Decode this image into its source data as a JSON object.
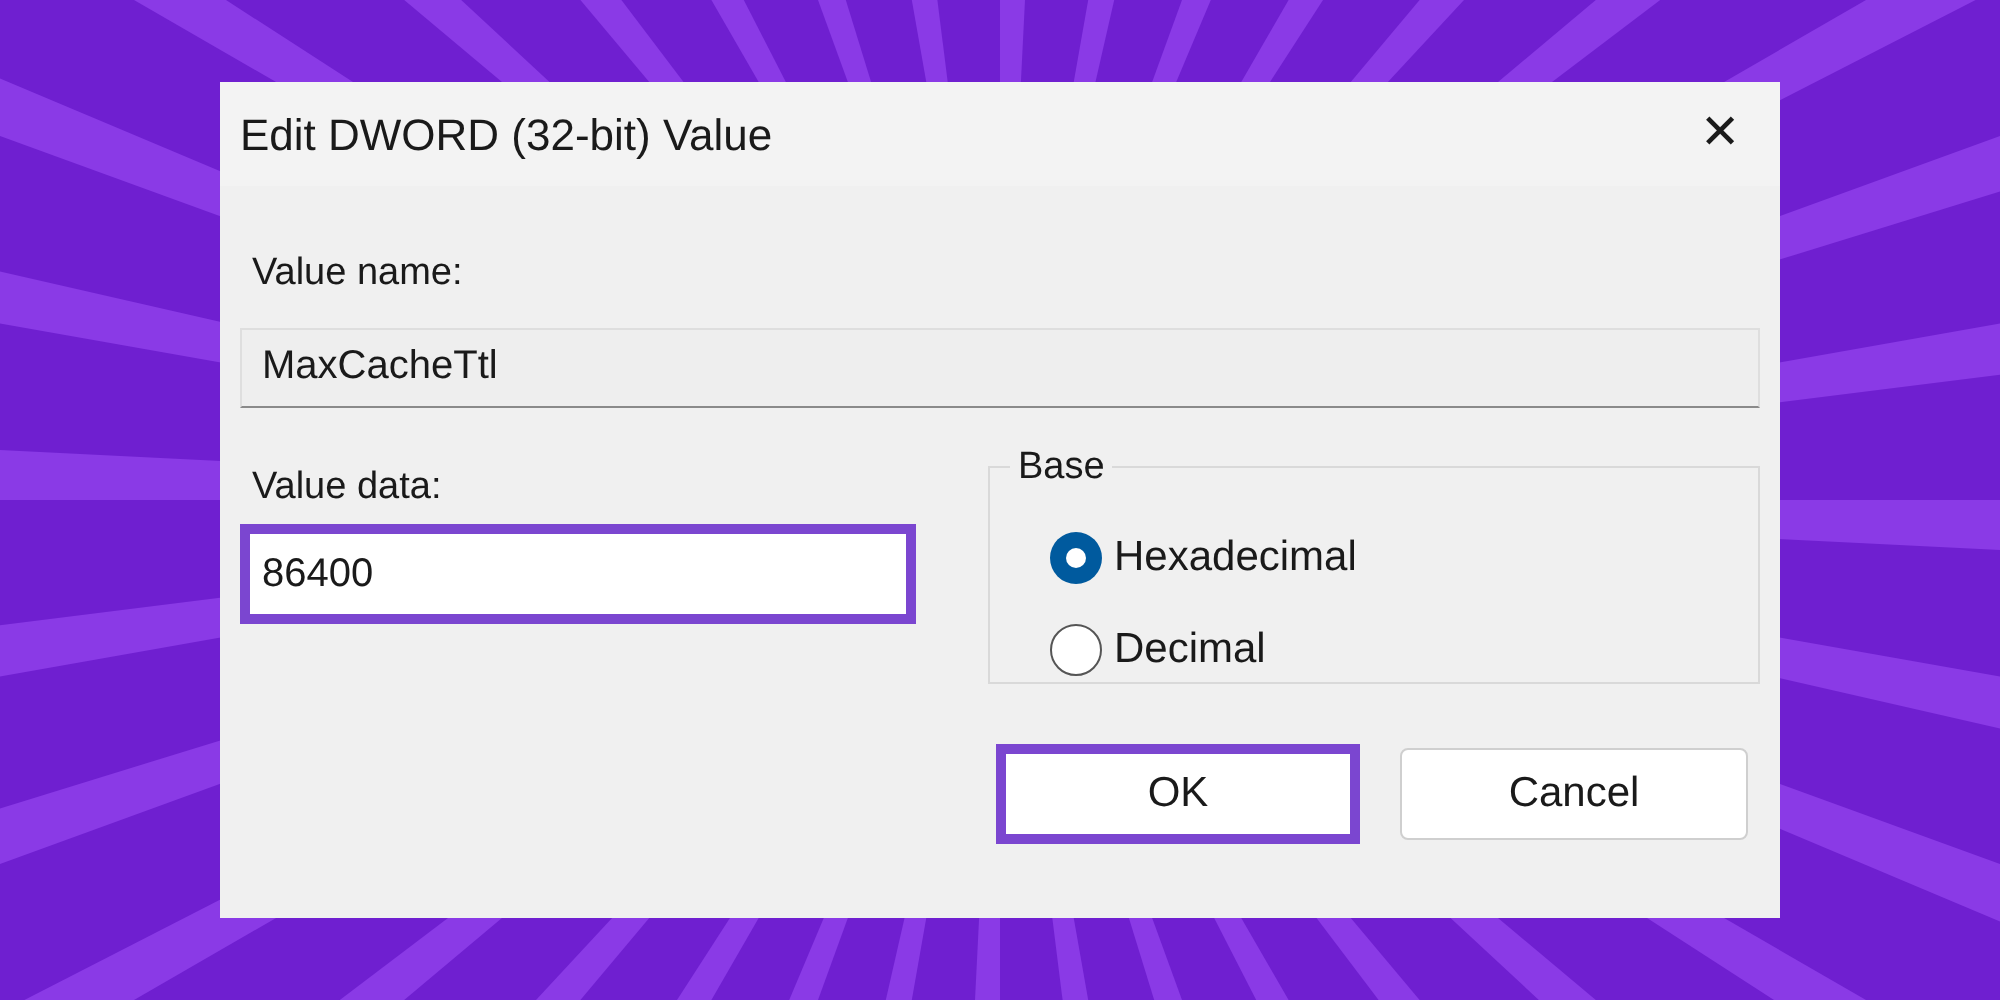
{
  "dialog": {
    "title": "Edit DWORD (32-bit) Value",
    "close_glyph": "✕",
    "name_label": "Value name:",
    "name_value": "MaxCacheTtl",
    "data_label": "Value data:",
    "data_value": "86400",
    "data_highlighted": true,
    "base": {
      "legend": "Base",
      "options": [
        {
          "label": "Hexadecimal",
          "selected": true
        },
        {
          "label": "Decimal",
          "selected": false
        }
      ]
    },
    "buttons": [
      {
        "label": "OK",
        "highlighted": true
      },
      {
        "label": "Cancel",
        "highlighted": false
      }
    ]
  }
}
